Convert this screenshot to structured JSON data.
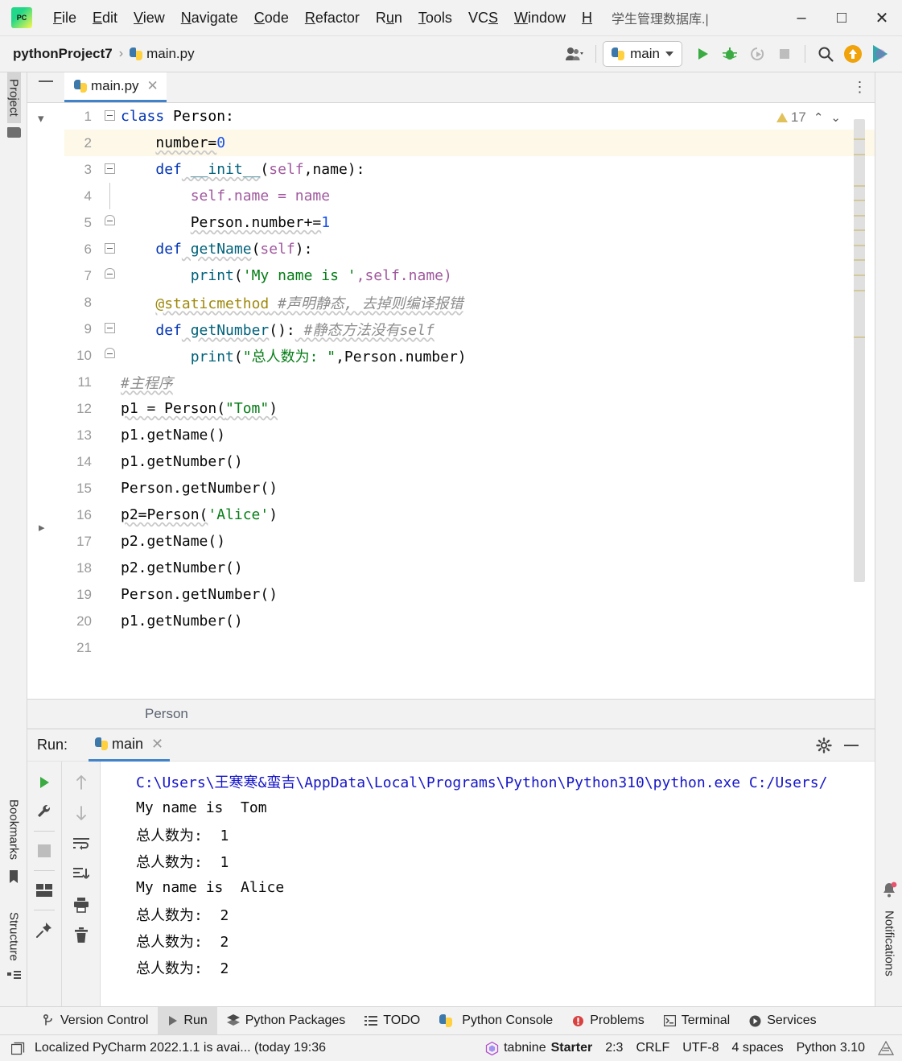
{
  "titlebar": {
    "logo_name": "pycharm-logo",
    "menus": [
      {
        "label": "File",
        "accel": "F"
      },
      {
        "label": "Edit",
        "accel": "E"
      },
      {
        "label": "View",
        "accel": "V"
      },
      {
        "label": "Navigate",
        "accel": "N"
      },
      {
        "label": "Code",
        "accel": "C"
      },
      {
        "label": "Refactor",
        "accel": "R"
      },
      {
        "label": "Run",
        "accel": "u"
      },
      {
        "label": "Tools",
        "accel": "T"
      },
      {
        "label": "VCS",
        "accel": "S"
      },
      {
        "label": "Window",
        "accel": "W"
      },
      {
        "label": "H",
        "accel": "H"
      }
    ],
    "window_title": "学生管理数据库.|",
    "minimize": "–",
    "maximize": "□",
    "close": "✕"
  },
  "navbar": {
    "project": "pythonProject7",
    "separator": "›",
    "file": "main.py",
    "run_config": "main",
    "icons": [
      "user-avatar-icon",
      "run-icon",
      "debug-icon",
      "coverage-icon",
      "stop-icon",
      "search-icon",
      "update-icon",
      "plugin-icon"
    ]
  },
  "left_strip": {
    "project_tab": "Project",
    "bookmarks_tab": "Bookmarks",
    "structure_tab": "Structure"
  },
  "right_strip": {
    "notifications_tab": "Notifications"
  },
  "editor": {
    "tab_label": "main.py",
    "tab_close": "✕",
    "more_actions": "⋮",
    "warning_count": "17",
    "warn_up": "⌃",
    "warn_down": "⌄",
    "breadcrumb": "Person",
    "lines": [
      {
        "no": "1",
        "fold": "start",
        "highlight": false,
        "indent": 0
      },
      {
        "no": "2",
        "fold": "none",
        "highlight": true,
        "indent": 1
      },
      {
        "no": "3",
        "fold": "start",
        "highlight": false,
        "indent": 1
      },
      {
        "no": "4",
        "fold": "bar",
        "highlight": false,
        "indent": 2
      },
      {
        "no": "5",
        "fold": "end",
        "highlight": false,
        "indent": 2
      },
      {
        "no": "6",
        "fold": "start",
        "highlight": false,
        "indent": 1
      },
      {
        "no": "7",
        "fold": "end",
        "highlight": false,
        "indent": 2
      },
      {
        "no": "8",
        "fold": "none",
        "highlight": false,
        "indent": 1
      },
      {
        "no": "9",
        "fold": "start",
        "highlight": false,
        "indent": 1
      },
      {
        "no": "10",
        "fold": "end",
        "highlight": false,
        "indent": 2
      },
      {
        "no": "11",
        "fold": "none",
        "highlight": false,
        "indent": 0
      },
      {
        "no": "12",
        "fold": "none",
        "highlight": false,
        "indent": 0
      },
      {
        "no": "13",
        "fold": "none",
        "highlight": false,
        "indent": 0
      },
      {
        "no": "14",
        "fold": "none",
        "highlight": false,
        "indent": 0
      },
      {
        "no": "15",
        "fold": "none",
        "highlight": false,
        "indent": 0
      },
      {
        "no": "16",
        "fold": "none",
        "highlight": false,
        "indent": 0
      },
      {
        "no": "17",
        "fold": "none",
        "highlight": false,
        "indent": 0
      },
      {
        "no": "18",
        "fold": "none",
        "highlight": false,
        "indent": 0
      },
      {
        "no": "19",
        "fold": "none",
        "highlight": false,
        "indent": 0
      },
      {
        "no": "20",
        "fold": "none",
        "highlight": false,
        "indent": 0
      },
      {
        "no": "21",
        "fold": "none",
        "highlight": false,
        "indent": 0
      }
    ],
    "code": {
      "l1_kw": "class",
      "l1_name": " Person:",
      "l2": "number=",
      "l2_num": "0",
      "l3_kw": "def",
      "l3_fn": " __init__",
      "l3_p1": "(",
      "l3_self": "self",
      "l3_rest": ",name):",
      "l4": "self.name = name",
      "l5": "Person.number+=",
      "l5_num": "1",
      "l6_kw": "def",
      "l6_fn": " getName",
      "l6_p1": "(",
      "l6_self": "self",
      "l6_rest": "):",
      "l7_fn": "print",
      "l7_p1": "(",
      "l7_str": "'My name is '",
      "l7_rest": ",self.name)",
      "l8_dec": "@staticmethod",
      "l8_cmt": " #声明静态, 去掉则编译报错",
      "l9_kw": "def",
      "l9_fn": " getNumber",
      "l9_rest": "():",
      "l9_cmt": " #静态方法没有self",
      "l10_fn": "print",
      "l10_p1": "(",
      "l10_str": "\"总人数为: \"",
      "l10_rest": ",Person.number)",
      "l11_cmt": "#主程序",
      "l12_a": "p1 = Person(",
      "l12_str": "\"Tom\"",
      "l12_b": ")",
      "l13": "p1.getName()",
      "l14": "p1.getNumber()",
      "l15": "Person.getNumber()",
      "l16_a": "p2=Person(",
      "l16_str": "'Alice'",
      "l16_b": ")",
      "l17": "p2.getName()",
      "l18": "p2.getNumber()",
      "l19": "Person.getNumber()",
      "l20": "p1.getNumber()",
      "l21": ""
    }
  },
  "run_panel": {
    "title": "Run:",
    "tab_label": "main",
    "tab_close": "✕",
    "settings_icon": "gear-icon",
    "minimize_icon": "minimize-icon",
    "toolbar_icons": [
      "rerun-icon",
      "wrench-icon",
      "stop-icon",
      "layout-icon",
      "pin-icon"
    ],
    "toolbar2_icons": [
      "up-arrow-icon",
      "down-arrow-icon",
      "soft-wrap-icon",
      "scroll-end-icon",
      "print-icon",
      "trash-icon"
    ],
    "output": [
      {
        "text": "C:\\Users\\王寒寒&蛮吉\\AppData\\Local\\Programs\\Python\\Python310\\python.exe C:/Users/",
        "type": "path"
      },
      {
        "text": "My name is  Tom",
        "type": "std"
      },
      {
        "text": "总人数为:  1",
        "type": "std"
      },
      {
        "text": "总人数为:  1",
        "type": "std"
      },
      {
        "text": "My name is  Alice",
        "type": "std"
      },
      {
        "text": "总人数为:  2",
        "type": "std"
      },
      {
        "text": "总人数为:  2",
        "type": "std"
      },
      {
        "text": "总人数为:  2",
        "type": "std"
      }
    ]
  },
  "bottom_tabs": [
    {
      "label": "Version Control",
      "icon": "branch-icon",
      "selected": false
    },
    {
      "label": "Run",
      "icon": "run-icon",
      "selected": true
    },
    {
      "label": "Python Packages",
      "icon": "packages-icon",
      "selected": false
    },
    {
      "label": "TODO",
      "icon": "todo-icon",
      "selected": false
    },
    {
      "label": "Python Console",
      "icon": "python-icon",
      "selected": false
    },
    {
      "label": "Problems",
      "icon": "problems-icon",
      "selected": false
    },
    {
      "label": "Terminal",
      "icon": "terminal-icon",
      "selected": false
    },
    {
      "label": "Services",
      "icon": "services-icon",
      "selected": false
    }
  ],
  "statusbar": {
    "notification_icon": "notification-box-icon",
    "message": "Localized PyCharm 2022.1.1 is avai... (today 19:36",
    "tabnine_brand": "tabnine",
    "tabnine_plan": "Starter",
    "caret": "2:3",
    "line_sep": "CRLF",
    "encoding": "UTF-8",
    "indent": "4 spaces",
    "interpreter": "Python 3.10",
    "lock_icon": "accessibility-icon"
  },
  "colors": {
    "accent": "#4282c8",
    "keyword": "#0033b3",
    "string": "#067d17",
    "comment": "#8c8c8c",
    "decorator": "#9e880d",
    "number": "#1750eb",
    "function": "#00627a",
    "panel_bg": "#f2f2f2",
    "editor_bg": "#ffffff",
    "highlight_line": "#fdf8e8",
    "console_path": "#1616c8"
  }
}
